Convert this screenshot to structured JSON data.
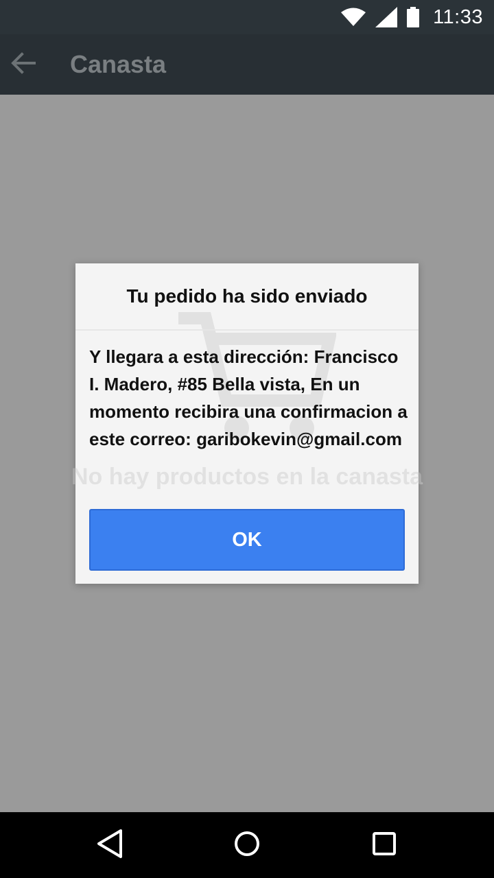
{
  "status_bar": {
    "time": "11:33",
    "icons": [
      "wifi-icon",
      "cell-signal-icon",
      "battery-icon"
    ]
  },
  "app_bar": {
    "title": "Canasta",
    "back_icon": "arrow-back-icon"
  },
  "content": {
    "empty_icon": "shopping-cart-icon",
    "empty_text": "No hay productos en la canasta"
  },
  "dialog": {
    "title": "Tu pedido ha sido enviado",
    "message": "Y llegara a esta dirección: Francisco I. Madero, #85 Bella vista, En un momento recibira una confirmacion a este correo: garibokevin@gmail.com",
    "ok_label": "OK"
  },
  "nav_bar": {
    "icons": [
      "nav-back-icon",
      "nav-home-icon",
      "nav-recents-icon"
    ]
  },
  "colors": {
    "status_bar": "#2b3338",
    "app_bar": "#282f34",
    "background": "#9a9a9a",
    "dialog": "#f4f4f4",
    "button": "#3b80f0"
  }
}
